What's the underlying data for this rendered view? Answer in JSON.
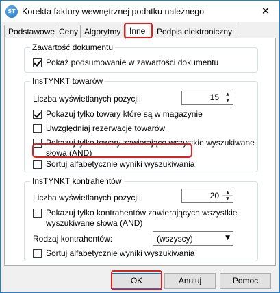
{
  "window": {
    "title": "Korekta faktury wewnętrznej podatku należnego",
    "icon_text": "ST",
    "close_glyph": "✕"
  },
  "tabs": [
    {
      "label": "Podstawowe",
      "active": false
    },
    {
      "label": "Ceny",
      "active": false
    },
    {
      "label": "Algorytmy",
      "active": false
    },
    {
      "label": "Inne",
      "active": true
    },
    {
      "label": "Podpis elektroniczny",
      "active": false
    }
  ],
  "zawartosc": {
    "legend": "Zawartość dokumentu",
    "show_summary": {
      "label": "Pokaż podsumowanie w zawartości dokumentu",
      "checked": true
    }
  },
  "instynkt_towarow": {
    "legend": "InsTYNKT towarów",
    "count_label": "Liczba wyświetlanych pozycji:",
    "count_value": "15",
    "only_in_stock": {
      "label": "Pokazuj tylko towary które są w magazynie",
      "checked": true
    },
    "reservations": {
      "label": "Uwzględniaj rezerwacje towarów",
      "checked": false
    },
    "all_words_line1": "Pokazuj tylko towary zawierające wszystkie wyszukiwane",
    "all_words_line2": "słowa (AND)",
    "all_words_checked": false,
    "sort_alpha": {
      "label": "Sortuj alfabetycznie wyniki wyszukiwania",
      "checked": false
    }
  },
  "instynkt_kontrahentow": {
    "legend": "InsTYNKT kontrahentów",
    "count_label": "Liczba wyświetlanych pozycji:",
    "count_value": "20",
    "all_words_line1": "Pokazuj tylko kontrahentów zawierających wszystkie",
    "all_words_line2": "wyszukiwane słowa (AND)",
    "all_words_checked": false,
    "type_label": "Rodzaj kontrahentów:",
    "type_value": "(wszyscy)",
    "sort_alpha": {
      "label": "Sortuj alfabetycznie wyniki wyszukiwania",
      "checked": false
    }
  },
  "buttons": {
    "ok": "OK",
    "cancel": "Anuluj",
    "help": "Pomoc"
  },
  "icons": {
    "spin_up": "▲",
    "spin_down": "▼",
    "dropdown": "▼"
  },
  "colors": {
    "highlight": "#e02020",
    "accent": "#1883d7"
  }
}
